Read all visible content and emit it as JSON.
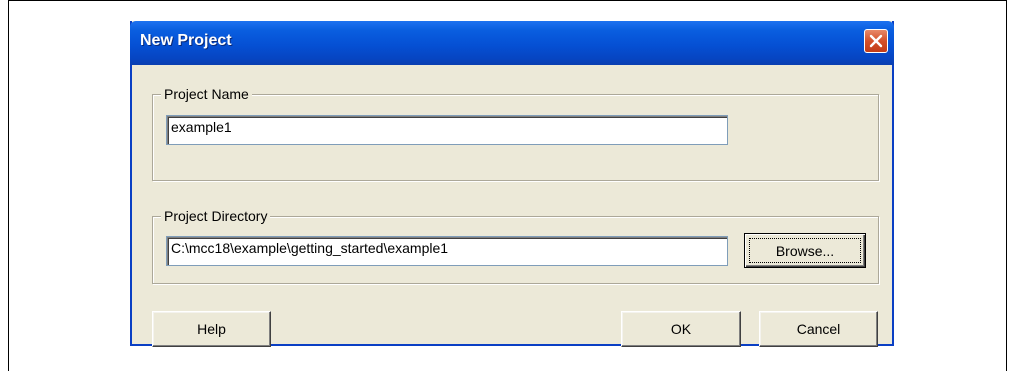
{
  "window": {
    "title": "New Project",
    "close_glyph": "×"
  },
  "project_name": {
    "label": "Project Name",
    "value": "example1"
  },
  "project_directory": {
    "label": "Project Directory",
    "value": "C:\\mcc18\\example\\getting_started\\example1",
    "browse_label": "Browse..."
  },
  "buttons": {
    "help": "Help",
    "ok": "OK",
    "cancel": "Cancel"
  },
  "colors": {
    "titlebar": "#0550d4",
    "close_button": "#d4502a",
    "dialog_face": "#ece9d8"
  },
  "icons": {
    "close": "close-icon"
  }
}
